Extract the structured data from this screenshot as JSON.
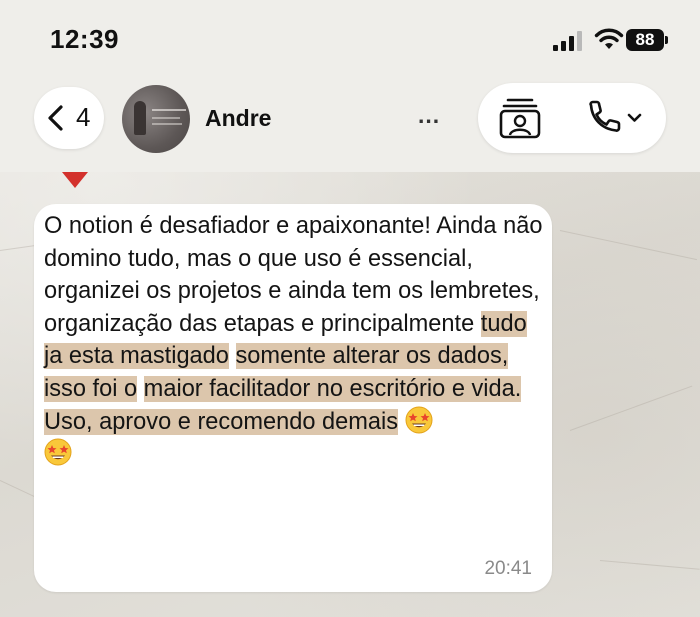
{
  "status_bar": {
    "time": "12:39",
    "battery": "88"
  },
  "header": {
    "back_count": "4",
    "contact_name": "Andre",
    "contact_name_tail": "..."
  },
  "message": {
    "reaction": "heart",
    "text_plain": "O notion é desafiador e apaixonante! Ainda não domino tudo, mas o que uso é essencial, organizei os projetos e ainda tem os lembretes, organização das etapas e principalmente ",
    "text_highlight_1": "tudo ja esta mastigado",
    "text_highlight_2": "somente alterar os dados, isso foi o",
    "text_highlight_3": "maior facilitador no escritório e vida.",
    "text_highlight_4": "Uso, aprovo e recomendo demais",
    "time": "20:41",
    "highlight_color": "#dcc6ac"
  },
  "colors": {
    "bubble": "#ffffff",
    "chrome": "#efeeea",
    "wallpaper": "#e6e4de",
    "heart": "#d3312c"
  }
}
